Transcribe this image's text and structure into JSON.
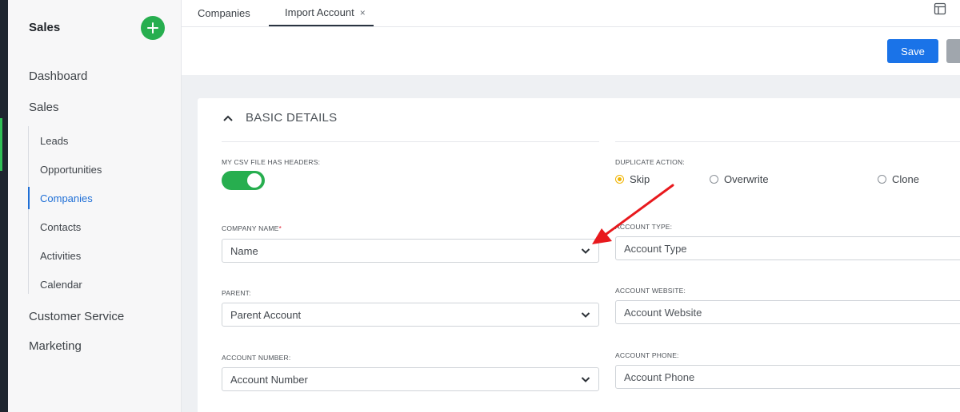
{
  "sidebar": {
    "title": "Sales",
    "nav": [
      {
        "label": "Dashboard"
      },
      {
        "label": "Sales"
      }
    ],
    "sub_items": [
      {
        "label": "Leads"
      },
      {
        "label": "Opportunities"
      },
      {
        "label": "Companies",
        "active": true
      },
      {
        "label": "Contacts"
      },
      {
        "label": "Activities"
      },
      {
        "label": "Calendar"
      }
    ],
    "nav_bottom": [
      {
        "label": "Customer Service"
      },
      {
        "label": "Marketing"
      }
    ]
  },
  "tabs": [
    {
      "label": "Companies"
    },
    {
      "label": "Import Account",
      "active": true,
      "close": "×"
    }
  ],
  "toolbar": {
    "save_label": "Save"
  },
  "section": {
    "title": "BASIC DETAILS"
  },
  "form": {
    "headers_label": "MY CSV FILE HAS HEADERS:",
    "headers_toggle_on": true,
    "duplicate_label": "DUPLICATE ACTION:",
    "duplicate_options": [
      {
        "label": "Skip",
        "selected": true
      },
      {
        "label": "Overwrite",
        "selected": false
      },
      {
        "label": "Clone",
        "selected": false
      }
    ],
    "company_name": {
      "label": "COMPANY NAME",
      "required_mark": "*",
      "value": "Name"
    },
    "parent": {
      "label": "PARENT:",
      "value": "Parent Account"
    },
    "account_number": {
      "label": "ACCOUNT NUMBER:",
      "value": "Account Number"
    },
    "account_type": {
      "label": "ACCOUNT TYPE:",
      "placeholder": "Account Type"
    },
    "account_website": {
      "label": "ACCOUNT WEBSITE:",
      "placeholder": "Account Website"
    },
    "account_phone": {
      "label": "ACCOUNT PHONE:",
      "placeholder": "Account Phone"
    }
  },
  "colors": {
    "accent_green": "#27ae4f",
    "primary_blue": "#1a73e8",
    "radio_selected": "#f1b400",
    "annotation_red": "#e8191d"
  },
  "icons": [
    "plus-icon",
    "close-icon",
    "layout-icon",
    "chevron-up-icon",
    "chevron-down-icon",
    "annotation-arrow"
  ]
}
